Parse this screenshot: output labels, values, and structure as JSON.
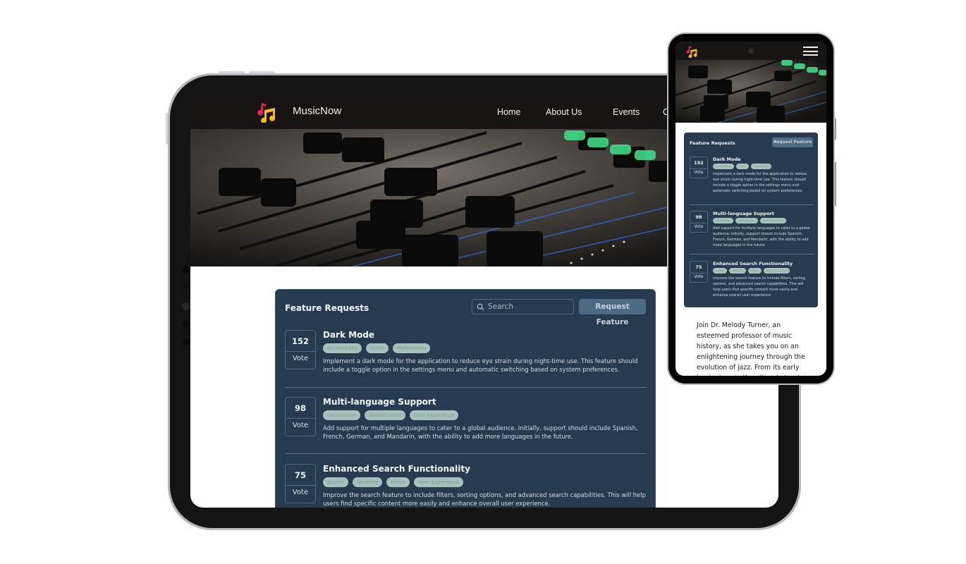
{
  "site": {
    "brand": "MusicNow",
    "nav": [
      "Home",
      "About Us",
      "Events",
      "C"
    ]
  },
  "feature_requests": {
    "title": "Feature Requests",
    "search_placeholder": "Search",
    "request_button": "Request Feature",
    "vote_label": "Vote",
    "items": [
      {
        "votes": "152",
        "title": "Dark Mode",
        "tags": [
          "Accessibility",
          "UI/UX",
          "Preferences"
        ],
        "description": "Implement a dark mode for the application to reduce eye strain during night-time use. This feature should include a toggle option in the settings menu and automatic switching based on system preferences."
      },
      {
        "votes": "98",
        "title": "Multi-language Support",
        "tags": [
          "Localization",
          "Globalization",
          "User Experience"
        ],
        "description": "Add support for multiple languages to cater to a global audience. Initially, support should include Spanish, French, German, and Mandarin, with the ability to add more languages in the future."
      },
      {
        "votes": "75",
        "title": "Enhanced Search Functionality",
        "tags": [
          "Search",
          "Usability",
          "Filters",
          "User Experience"
        ],
        "description": "Improve the search feature to include filters, sorting options, and advanced search capabilities. This will help users find specific content more easily and enhance overall user experience."
      }
    ]
  },
  "event_text": "Join Dr. Melody Turner, an esteemed professor of music history, as she takes you on an enlightening journey through the evolution of jazz. From its early beginnings in the vibrant streets",
  "colors": {
    "nav_bg": "#191414",
    "card_bg": "#263b50",
    "button_bg": "#4e6b85",
    "tag_bg": "#a6c1bb",
    "logo_pink": "#e0245e",
    "logo_yellow": "#f5b91a"
  }
}
